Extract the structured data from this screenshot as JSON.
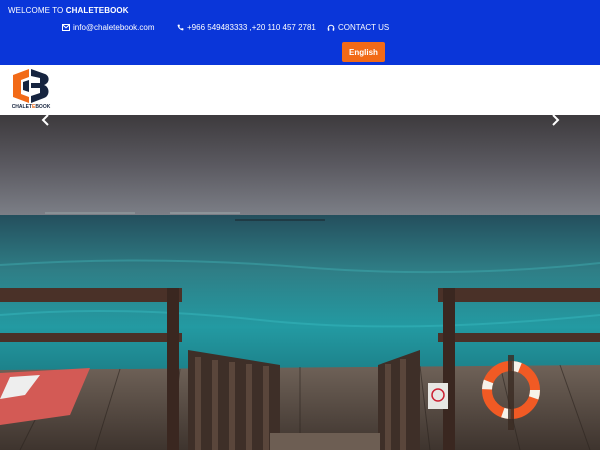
{
  "topbar": {
    "welcome_prefix": "WELCOME TO",
    "welcome_brand": "CHALETEBOOK",
    "email": "info@chaletebook.com",
    "phone": "+966 549483333 ,+20 110 457 2781",
    "contact_label": "CONTACT US",
    "language_button": "English",
    "icons": {
      "email": "envelope-icon",
      "phone": "phone-icon",
      "contact": "headset-icon"
    },
    "colors": {
      "background": "#0a36d9",
      "button": "#f26a17"
    }
  },
  "header": {
    "logo_letters": "CB",
    "logo_text_main": "CHALET",
    "logo_text_accent": "E",
    "logo_text_end": "BOOK"
  },
  "hero": {
    "prev_icon": "chevron-left-icon",
    "next_icon": "chevron-right-icon"
  }
}
